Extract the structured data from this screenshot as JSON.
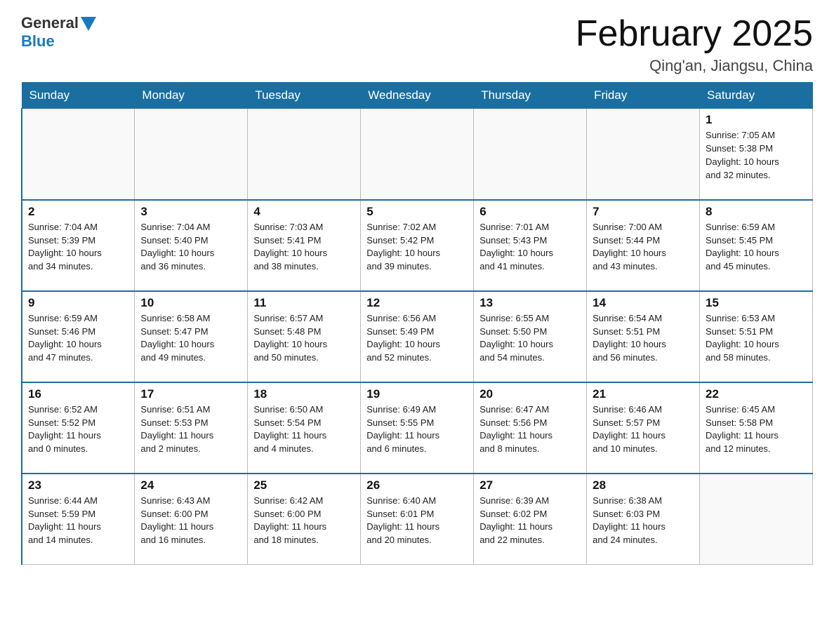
{
  "header": {
    "logo": {
      "general": "General",
      "blue": "Blue"
    },
    "title": "February 2025",
    "location": "Qing'an, Jiangsu, China"
  },
  "weekdays": [
    "Sunday",
    "Monday",
    "Tuesday",
    "Wednesday",
    "Thursday",
    "Friday",
    "Saturday"
  ],
  "weeks": [
    [
      {
        "day": "",
        "info": ""
      },
      {
        "day": "",
        "info": ""
      },
      {
        "day": "",
        "info": ""
      },
      {
        "day": "",
        "info": ""
      },
      {
        "day": "",
        "info": ""
      },
      {
        "day": "",
        "info": ""
      },
      {
        "day": "1",
        "info": "Sunrise: 7:05 AM\nSunset: 5:38 PM\nDaylight: 10 hours\nand 32 minutes."
      }
    ],
    [
      {
        "day": "2",
        "info": "Sunrise: 7:04 AM\nSunset: 5:39 PM\nDaylight: 10 hours\nand 34 minutes."
      },
      {
        "day": "3",
        "info": "Sunrise: 7:04 AM\nSunset: 5:40 PM\nDaylight: 10 hours\nand 36 minutes."
      },
      {
        "day": "4",
        "info": "Sunrise: 7:03 AM\nSunset: 5:41 PM\nDaylight: 10 hours\nand 38 minutes."
      },
      {
        "day": "5",
        "info": "Sunrise: 7:02 AM\nSunset: 5:42 PM\nDaylight: 10 hours\nand 39 minutes."
      },
      {
        "day": "6",
        "info": "Sunrise: 7:01 AM\nSunset: 5:43 PM\nDaylight: 10 hours\nand 41 minutes."
      },
      {
        "day": "7",
        "info": "Sunrise: 7:00 AM\nSunset: 5:44 PM\nDaylight: 10 hours\nand 43 minutes."
      },
      {
        "day": "8",
        "info": "Sunrise: 6:59 AM\nSunset: 5:45 PM\nDaylight: 10 hours\nand 45 minutes."
      }
    ],
    [
      {
        "day": "9",
        "info": "Sunrise: 6:59 AM\nSunset: 5:46 PM\nDaylight: 10 hours\nand 47 minutes."
      },
      {
        "day": "10",
        "info": "Sunrise: 6:58 AM\nSunset: 5:47 PM\nDaylight: 10 hours\nand 49 minutes."
      },
      {
        "day": "11",
        "info": "Sunrise: 6:57 AM\nSunset: 5:48 PM\nDaylight: 10 hours\nand 50 minutes."
      },
      {
        "day": "12",
        "info": "Sunrise: 6:56 AM\nSunset: 5:49 PM\nDaylight: 10 hours\nand 52 minutes."
      },
      {
        "day": "13",
        "info": "Sunrise: 6:55 AM\nSunset: 5:50 PM\nDaylight: 10 hours\nand 54 minutes."
      },
      {
        "day": "14",
        "info": "Sunrise: 6:54 AM\nSunset: 5:51 PM\nDaylight: 10 hours\nand 56 minutes."
      },
      {
        "day": "15",
        "info": "Sunrise: 6:53 AM\nSunset: 5:51 PM\nDaylight: 10 hours\nand 58 minutes."
      }
    ],
    [
      {
        "day": "16",
        "info": "Sunrise: 6:52 AM\nSunset: 5:52 PM\nDaylight: 11 hours\nand 0 minutes."
      },
      {
        "day": "17",
        "info": "Sunrise: 6:51 AM\nSunset: 5:53 PM\nDaylight: 11 hours\nand 2 minutes."
      },
      {
        "day": "18",
        "info": "Sunrise: 6:50 AM\nSunset: 5:54 PM\nDaylight: 11 hours\nand 4 minutes."
      },
      {
        "day": "19",
        "info": "Sunrise: 6:49 AM\nSunset: 5:55 PM\nDaylight: 11 hours\nand 6 minutes."
      },
      {
        "day": "20",
        "info": "Sunrise: 6:47 AM\nSunset: 5:56 PM\nDaylight: 11 hours\nand 8 minutes."
      },
      {
        "day": "21",
        "info": "Sunrise: 6:46 AM\nSunset: 5:57 PM\nDaylight: 11 hours\nand 10 minutes."
      },
      {
        "day": "22",
        "info": "Sunrise: 6:45 AM\nSunset: 5:58 PM\nDaylight: 11 hours\nand 12 minutes."
      }
    ],
    [
      {
        "day": "23",
        "info": "Sunrise: 6:44 AM\nSunset: 5:59 PM\nDaylight: 11 hours\nand 14 minutes."
      },
      {
        "day": "24",
        "info": "Sunrise: 6:43 AM\nSunset: 6:00 PM\nDaylight: 11 hours\nand 16 minutes."
      },
      {
        "day": "25",
        "info": "Sunrise: 6:42 AM\nSunset: 6:00 PM\nDaylight: 11 hours\nand 18 minutes."
      },
      {
        "day": "26",
        "info": "Sunrise: 6:40 AM\nSunset: 6:01 PM\nDaylight: 11 hours\nand 20 minutes."
      },
      {
        "day": "27",
        "info": "Sunrise: 6:39 AM\nSunset: 6:02 PM\nDaylight: 11 hours\nand 22 minutes."
      },
      {
        "day": "28",
        "info": "Sunrise: 6:38 AM\nSunset: 6:03 PM\nDaylight: 11 hours\nand 24 minutes."
      },
      {
        "day": "",
        "info": ""
      }
    ]
  ]
}
